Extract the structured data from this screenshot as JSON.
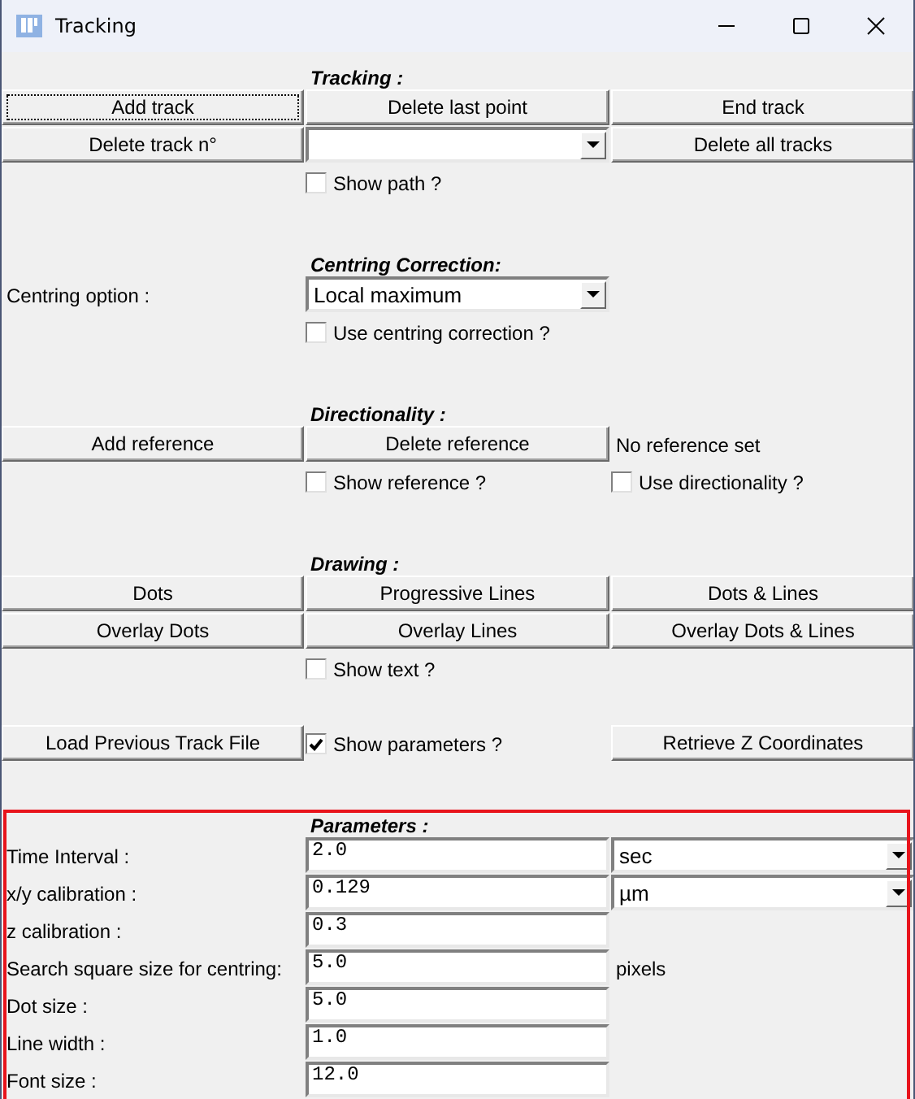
{
  "window": {
    "title": "Tracking"
  },
  "sections": [
    {
      "heading": "Tracking :",
      "rows": [
        [
          {
            "kind": "button",
            "label": "Add track",
            "focused": true
          },
          {
            "kind": "button",
            "label": "Delete last point"
          },
          {
            "kind": "button",
            "label": "End track"
          }
        ],
        [
          {
            "kind": "button",
            "label": "Delete track n°"
          },
          {
            "kind": "dropdown"
          },
          {
            "kind": "button",
            "label": "Delete all tracks"
          }
        ],
        [
          {
            "kind": "blank"
          },
          {
            "kind": "checkbox",
            "label": "Show path ?",
            "checked": false
          }
        ]
      ]
    },
    {
      "heading": "Centring Correction:",
      "rows": [
        [
          {
            "kind": "label",
            "label": "Centring option :"
          },
          {
            "kind": "dropdown",
            "value": "Local maximum"
          }
        ],
        [
          {
            "kind": "blank"
          },
          {
            "kind": "checkbox",
            "label": "Use centring correction ?",
            "checked": false
          }
        ]
      ]
    },
    {
      "heading": "Directionality :",
      "rows": [
        [
          {
            "kind": "button",
            "label": "Add reference"
          },
          {
            "kind": "button",
            "label": "Delete reference"
          },
          {
            "kind": "label",
            "label": "No reference set"
          }
        ],
        [
          {
            "kind": "blank"
          },
          {
            "kind": "checkbox",
            "label": "Show reference ?",
            "checked": false
          },
          {
            "kind": "checkbox",
            "label": "Use directionality ?",
            "checked": false
          }
        ]
      ]
    },
    {
      "heading": "Drawing :",
      "rows": [
        [
          {
            "kind": "button",
            "label": "Dots"
          },
          {
            "kind": "button",
            "label": "Progressive Lines"
          },
          {
            "kind": "button",
            "label": "Dots & Lines"
          }
        ],
        [
          {
            "kind": "button",
            "label": "Overlay Dots"
          },
          {
            "kind": "button",
            "label": "Overlay Lines"
          },
          {
            "kind": "button",
            "label": "Overlay Dots & Lines"
          }
        ],
        [
          {
            "kind": "blank"
          },
          {
            "kind": "checkbox",
            "label": "Show text ?",
            "checked": false
          }
        ]
      ]
    },
    {
      "rows": [
        [
          {
            "kind": "button",
            "label": "Load Previous Track File"
          },
          {
            "kind": "checkbox",
            "label": "Show parameters ?",
            "checked": true
          },
          {
            "kind": "button",
            "label": "Retrieve Z Coordinates"
          }
        ]
      ]
    },
    {
      "heading": "Parameters :",
      "highlighted": true,
      "rows": [
        [
          {
            "kind": "label",
            "label": "Time Interval :"
          },
          {
            "kind": "field",
            "value": "2.0"
          },
          {
            "kind": "dropdown",
            "value": "sec"
          }
        ],
        [
          {
            "kind": "label",
            "label": "x/y calibration :"
          },
          {
            "kind": "field",
            "value": "0.129"
          },
          {
            "kind": "dropdown",
            "value": "µm"
          }
        ],
        [
          {
            "kind": "label",
            "label": "z calibration :"
          },
          {
            "kind": "field",
            "value": "0.3"
          }
        ],
        [
          {
            "kind": "label",
            "label": "Search square size for centring:"
          },
          {
            "kind": "field",
            "value": "5.0"
          },
          {
            "kind": "label",
            "label": "pixels"
          }
        ],
        [
          {
            "kind": "label",
            "label": "Dot size :"
          },
          {
            "kind": "field",
            "value": "5.0"
          }
        ],
        [
          {
            "kind": "label",
            "label": "Line width :"
          },
          {
            "kind": "field",
            "value": "1.0"
          }
        ],
        [
          {
            "kind": "label",
            "label": "Font size :"
          },
          {
            "kind": "field",
            "value": "12.0"
          }
        ]
      ]
    }
  ]
}
